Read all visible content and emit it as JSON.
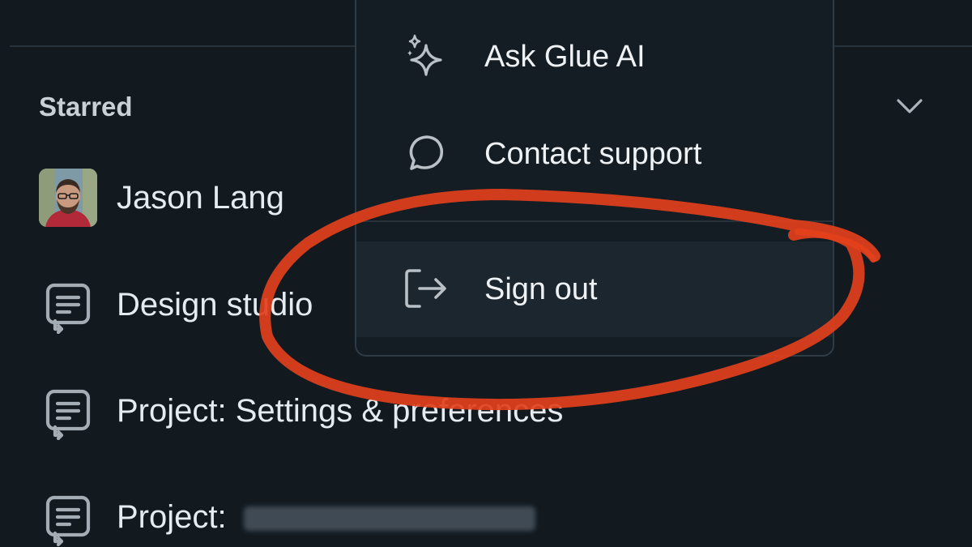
{
  "sidebar": {
    "section_title": "Starred",
    "items": [
      {
        "label": "Jason Lang",
        "icon": "avatar"
      },
      {
        "label": "Design studio",
        "icon": "thread-icon"
      },
      {
        "label": "Project: Settings & preferences",
        "icon": "thread-icon"
      },
      {
        "label": "Project:",
        "icon": "thread-icon"
      }
    ]
  },
  "menu": {
    "items": [
      {
        "label": "Ask Glue AI",
        "icon": "sparkles-icon"
      },
      {
        "label": "Contact support",
        "icon": "chat-bubble-icon"
      },
      {
        "label": "Sign out",
        "icon": "sign-out-icon"
      }
    ]
  },
  "colors": {
    "background": "#121a20",
    "annotation": "#e2401c"
  }
}
